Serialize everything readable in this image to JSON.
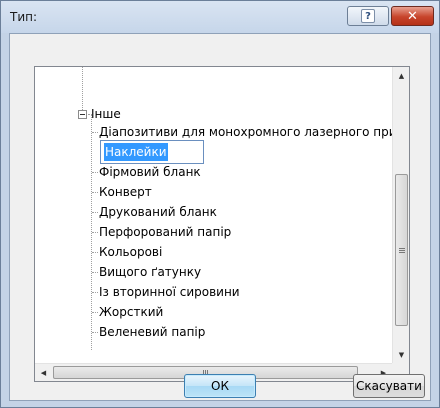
{
  "window": {
    "title": "Тип:",
    "help_label": "?",
    "close_label": "✕"
  },
  "tree": {
    "root": {
      "label": "Інше",
      "expander": "−",
      "expanded": true
    },
    "editing_value": "Наклейки",
    "children": [
      {
        "label": "Діапозитиви для монохромного лазерного принтера"
      },
      {
        "label": "Наклейки"
      },
      {
        "label": "Фірмовий бланк"
      },
      {
        "label": "Конверт"
      },
      {
        "label": "Друкований бланк"
      },
      {
        "label": "Перфорований папір"
      },
      {
        "label": "Кольорові"
      },
      {
        "label": "Вищого ґатунку"
      },
      {
        "label": "Із вторинної сировини"
      },
      {
        "label": "Жорсткий"
      },
      {
        "label": "Веленевий папір"
      }
    ]
  },
  "scrollbars": {
    "up_arrow": "▲",
    "down_arrow": "▼",
    "left_arrow": "◀",
    "right_arrow": "▶"
  },
  "buttons": {
    "ok": "ОК",
    "cancel": "Скасувати"
  },
  "colors": {
    "selection": "#3399ff",
    "close_button": "#c7442b",
    "ok_button": "#bde4f7"
  }
}
